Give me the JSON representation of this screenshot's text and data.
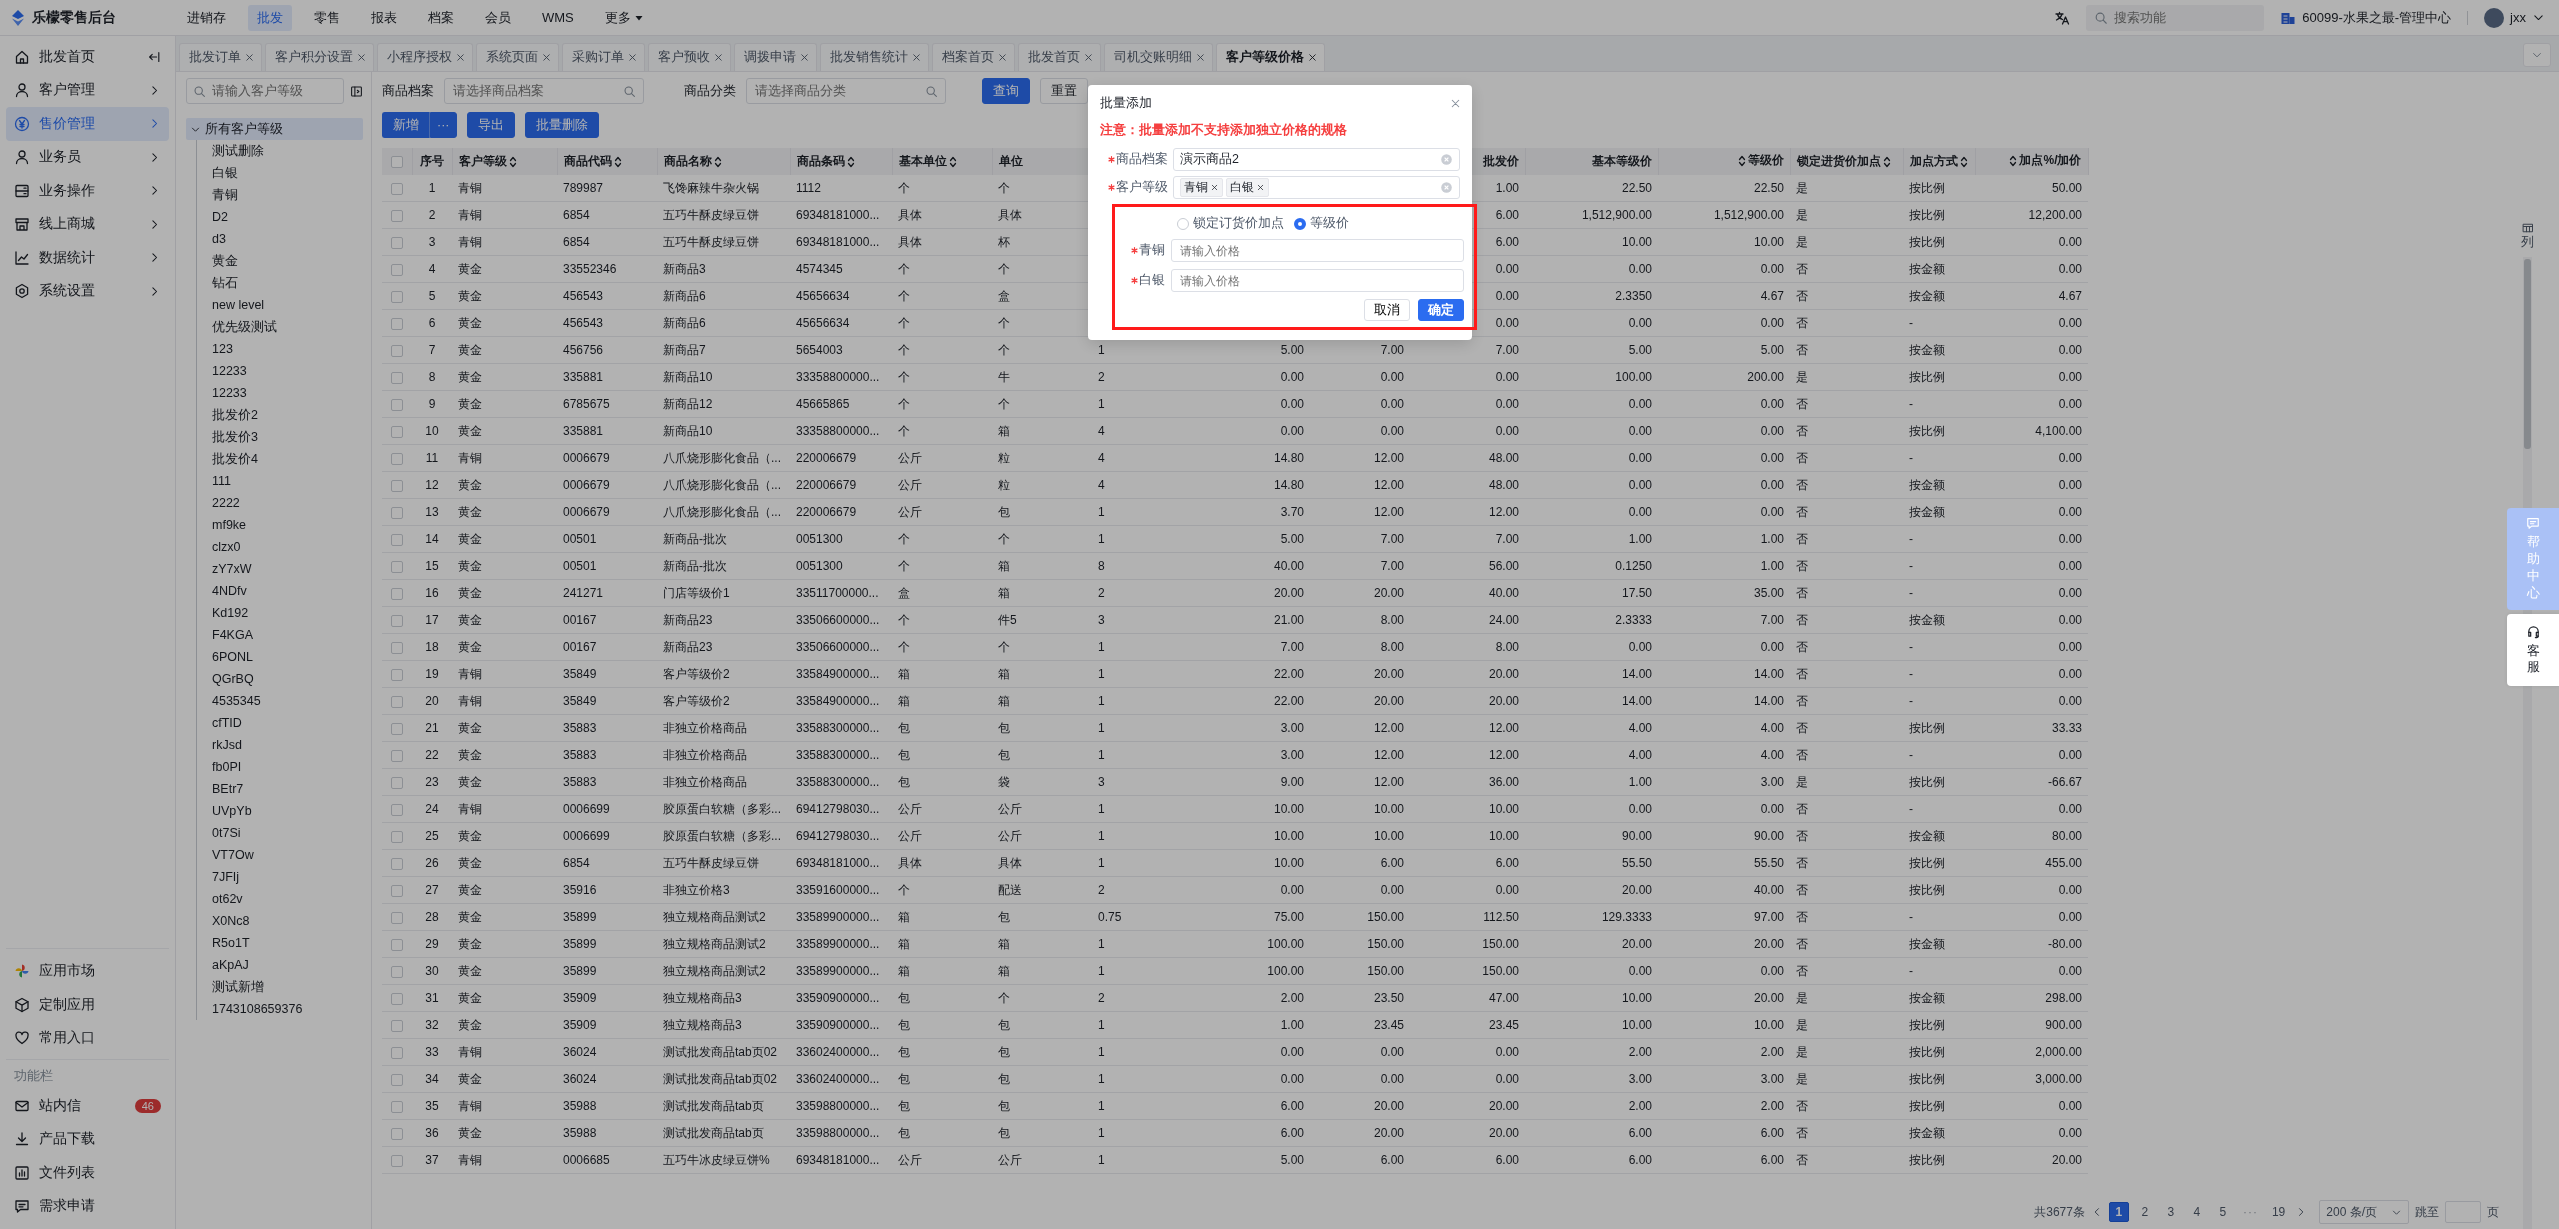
{
  "header": {
    "logo": "乐檬零售后台",
    "menu": [
      {
        "label": "进销存",
        "selected": false,
        "has_menu": false
      },
      {
        "label": "批发",
        "selected": true,
        "has_menu": false
      },
      {
        "label": "零售",
        "selected": false,
        "has_menu": false
      },
      {
        "label": "报表",
        "selected": false,
        "has_menu": false
      },
      {
        "label": "档案",
        "selected": false,
        "has_menu": false
      },
      {
        "label": "会员",
        "selected": false,
        "has_menu": false
      },
      {
        "label": "WMS",
        "selected": false,
        "has_menu": false
      },
      {
        "label": "更多",
        "selected": false,
        "has_menu": true
      }
    ],
    "search": {
      "placeholder": "搜索功能"
    },
    "org": "60099-水果之最-管理中心",
    "user": "jxx"
  },
  "sidebar": {
    "items": [
      {
        "label": "批发首页",
        "selected": false
      },
      {
        "label": "客户管理",
        "selected": false
      },
      {
        "label": "售价管理",
        "selected": true
      },
      {
        "label": "业务员",
        "selected": false
      },
      {
        "label": "业务操作",
        "selected": false
      },
      {
        "label": "线上商城",
        "selected": false
      },
      {
        "label": "数据统计",
        "selected": false
      },
      {
        "label": "系统设置",
        "selected": false
      }
    ],
    "apps": [
      "应用市场",
      "定制应用",
      "常用入口"
    ],
    "section_title": "功能栏",
    "tools": [
      {
        "label": "站内信",
        "badge": "46"
      },
      {
        "label": "产品下载"
      },
      {
        "label": "文件列表"
      },
      {
        "label": "需求申请"
      }
    ]
  },
  "tabs": [
    {
      "label": "批发订单",
      "selected": false
    },
    {
      "label": "客户积分设置",
      "selected": false
    },
    {
      "label": "小程序授权",
      "selected": false
    },
    {
      "label": "系统页面",
      "selected": false
    },
    {
      "label": "采购订单",
      "selected": false
    },
    {
      "label": "客户预收",
      "selected": false
    },
    {
      "label": "调拨申请",
      "selected": false
    },
    {
      "label": "批发销售统计",
      "selected": false
    },
    {
      "label": "档案首页",
      "selected": false
    },
    {
      "label": "批发首页",
      "selected": false
    },
    {
      "label": "司机交账明细",
      "selected": false
    },
    {
      "label": "客户等级价格",
      "selected": true
    }
  ],
  "tree": {
    "search_placeholder": "请输入客户等级",
    "root": {
      "label": "所有客户等级",
      "expanded": true,
      "selected": true,
      "children": [
        {
          "label": "测试删除",
          "selected": false
        },
        {
          "label": "白银",
          "selected": false
        },
        {
          "label": "青铜",
          "selected": false
        },
        {
          "label": "D2",
          "selected": false
        },
        {
          "label": "d3",
          "selected": false
        },
        {
          "label": "黄金",
          "selected": false
        },
        {
          "label": "钻石",
          "selected": false
        },
        {
          "label": "new level",
          "selected": false
        },
        {
          "label": "优先级测试",
          "selected": false
        },
        {
          "label": "123",
          "selected": false
        },
        {
          "label": "12233",
          "selected": false
        },
        {
          "label": "12233",
          "selected": false
        },
        {
          "label": "批发价2",
          "selected": false
        },
        {
          "label": "批发价3",
          "selected": false
        },
        {
          "label": "批发价4",
          "selected": false
        },
        {
          "label": "111",
          "selected": false
        },
        {
          "label": "2222",
          "selected": false
        },
        {
          "label": "mf9ke",
          "selected": false
        },
        {
          "label": "clzx0",
          "selected": false
        },
        {
          "label": "zY7xW",
          "selected": false
        },
        {
          "label": "4NDfv",
          "selected": false
        },
        {
          "label": "Kd192",
          "selected": false
        },
        {
          "label": "F4KGA",
          "selected": false
        },
        {
          "label": "6PONL",
          "selected": false
        },
        {
          "label": "QGrBQ",
          "selected": false
        },
        {
          "label": "4535345",
          "selected": false
        },
        {
          "label": "cfTID",
          "selected": false
        },
        {
          "label": "rkJsd",
          "selected": false
        },
        {
          "label": "fb0PI",
          "selected": false
        },
        {
          "label": "BEtr7",
          "selected": false
        },
        {
          "label": "UVpYb",
          "selected": false
        },
        {
          "label": "0t7Si",
          "selected": false
        },
        {
          "label": "VT7Ow",
          "selected": false
        },
        {
          "label": "7JFIj",
          "selected": false
        },
        {
          "label": "ot62v",
          "selected": false
        },
        {
          "label": "X0Nc8",
          "selected": false
        },
        {
          "label": "R5o1T",
          "selected": false
        },
        {
          "label": "aKpAJ",
          "selected": false
        },
        {
          "label": "测试新增",
          "selected": false
        },
        {
          "label": "1743108659376",
          "selected": false
        }
      ]
    }
  },
  "filters": [
    {
      "label": "商品档案",
      "placeholder": "请选择商品档案"
    },
    {
      "label": "商品分类",
      "placeholder": "请选择商品分类"
    }
  ],
  "filter_buttons": [
    {
      "label": "查询",
      "primary": true
    },
    {
      "label": "重置",
      "primary": false
    }
  ],
  "toolbar": {
    "add": "新增",
    "add_more": "···",
    "buttons": [
      "导出",
      "批量删除"
    ]
  },
  "table": {
    "all_checked": false,
    "columns": [
      {
        "label": "序号",
        "sort_before": false,
        "sort_after": false
      },
      {
        "label": "客户等级",
        "sort_before": false,
        "sort_after": true
      },
      {
        "label": "商品代码",
        "sort_before": false,
        "sort_after": true
      },
      {
        "label": "商品名称",
        "sort_before": false,
        "sort_after": true
      },
      {
        "label": "商品条码",
        "sort_before": false,
        "sort_after": true
      },
      {
        "label": "基本单位",
        "sort_before": false,
        "sort_after": true
      },
      {
        "label": "单位",
        "sort_before": false,
        "sort_after": false
      },
      null,
      null,
      null,
      {
        "label": "批发价",
        "sort_before": false,
        "sort_after": false
      },
      {
        "label": "基本等级价",
        "sort_before": false,
        "sort_after": false
      },
      {
        "label": "等级价",
        "sort_before": true,
        "sort_after": false
      },
      {
        "label": "锁定进货价加点",
        "sort_before": false,
        "sort_after": true
      },
      {
        "label": "加点方式",
        "sort_before": false,
        "sort_after": true
      },
      {
        "label": "加点%/加价",
        "sort_before": true,
        "sort_after": false
      }
    ],
    "rows": [
      {
        "checked": false,
        "cells": [
          "1",
          "青铜",
          "789987",
          "飞馋麻辣牛杂火锅",
          "1112",
          "个",
          "个",
          null,
          null,
          null,
          "1.00",
          "22.50",
          "22.50",
          "是",
          "按比例",
          "50.00"
        ]
      },
      {
        "checked": false,
        "cells": [
          "2",
          "青铜",
          "6854",
          "五巧牛酥皮绿豆饼",
          "69348181000...",
          "具体",
          "具体",
          null,
          null,
          null,
          "6.00",
          "1,512,900.00",
          "1,512,900.00",
          "是",
          "按比例",
          "12,200.00"
        ]
      },
      {
        "checked": false,
        "cells": [
          "3",
          "青铜",
          "6854",
          "五巧牛酥皮绿豆饼",
          "69348181000...",
          "具体",
          "杯",
          null,
          null,
          null,
          "6.00",
          "10.00",
          "10.00",
          "是",
          "按比例",
          "0.00"
        ]
      },
      {
        "checked": false,
        "cells": [
          "4",
          "黄金",
          "33552346",
          "新商品3",
          "4574345",
          "个",
          "个",
          null,
          null,
          null,
          "0.00",
          "0.00",
          "0.00",
          "否",
          "按金额",
          "0.00"
        ]
      },
      {
        "checked": false,
        "cells": [
          "5",
          "黄金",
          "456543",
          "新商品6",
          "45656634",
          "个",
          "盒",
          null,
          null,
          null,
          "0.00",
          "2.3350",
          "4.67",
          "否",
          "按金额",
          "4.67"
        ]
      },
      {
        "checked": false,
        "cells": [
          "6",
          "黄金",
          "456543",
          "新商品6",
          "45656634",
          "个",
          "个",
          null,
          null,
          null,
          "0.00",
          "0.00",
          "0.00",
          "否",
          "-",
          "0.00"
        ]
      },
      {
        "checked": false,
        "cells": [
          "7",
          "黄金",
          "456756",
          "新商品7",
          "5654003",
          "个",
          "个",
          "1",
          "5.00",
          "7.00",
          "7.00",
          "5.00",
          "5.00",
          "否",
          "按金额",
          "0.00"
        ]
      },
      {
        "checked": false,
        "cells": [
          "8",
          "黄金",
          "335881",
          "新商品10",
          "33358800000...",
          "个",
          "牛",
          "2",
          "0.00",
          "0.00",
          "0.00",
          "100.00",
          "200.00",
          "是",
          "按比例",
          "0.00"
        ]
      },
      {
        "checked": false,
        "cells": [
          "9",
          "黄金",
          "6785675",
          "新商品12",
          "45665865",
          "个",
          "个",
          "1",
          "0.00",
          "0.00",
          "0.00",
          "0.00",
          "0.00",
          "否",
          "-",
          "0.00"
        ]
      },
      {
        "checked": false,
        "cells": [
          "10",
          "黄金",
          "335881",
          "新商品10",
          "33358800000...",
          "个",
          "箱",
          "4",
          "0.00",
          "0.00",
          "0.00",
          "0.00",
          "0.00",
          "否",
          "按比例",
          "4,100.00"
        ]
      },
      {
        "checked": false,
        "cells": [
          "11",
          "青铜",
          "0006679",
          "八爪烧形膨化食品（...",
          "220006679",
          "公斤",
          "粒",
          "4",
          "14.80",
          "12.00",
          "48.00",
          "0.00",
          "0.00",
          "否",
          "-",
          "0.00"
        ]
      },
      {
        "checked": false,
        "cells": [
          "12",
          "黄金",
          "0006679",
          "八爪烧形膨化食品（...",
          "220006679",
          "公斤",
          "粒",
          "4",
          "14.80",
          "12.00",
          "48.00",
          "0.00",
          "0.00",
          "否",
          "按金额",
          "0.00"
        ]
      },
      {
        "checked": false,
        "cells": [
          "13",
          "黄金",
          "0006679",
          "八爪烧形膨化食品（...",
          "220006679",
          "公斤",
          "包",
          "1",
          "3.70",
          "12.00",
          "12.00",
          "0.00",
          "0.00",
          "否",
          "按金额",
          "0.00"
        ]
      },
      {
        "checked": false,
        "cells": [
          "14",
          "黄金",
          "00501",
          "新商品-批次",
          "0051300",
          "个",
          "个",
          "1",
          "5.00",
          "7.00",
          "7.00",
          "1.00",
          "1.00",
          "否",
          "-",
          "0.00"
        ]
      },
      {
        "checked": false,
        "cells": [
          "15",
          "黄金",
          "00501",
          "新商品-批次",
          "0051300",
          "个",
          "箱",
          "8",
          "40.00",
          "7.00",
          "56.00",
          "0.1250",
          "1.00",
          "否",
          "-",
          "0.00"
        ]
      },
      {
        "checked": false,
        "cells": [
          "16",
          "黄金",
          "241271",
          "门店等级价1",
          "33511700000...",
          "盒",
          "箱",
          "2",
          "20.00",
          "20.00",
          "40.00",
          "17.50",
          "35.00",
          "否",
          "-",
          "0.00"
        ]
      },
      {
        "checked": false,
        "cells": [
          "17",
          "黄金",
          "00167",
          "新商品23",
          "33506600000...",
          "个",
          "件5",
          "3",
          "21.00",
          "8.00",
          "24.00",
          "2.3333",
          "7.00",
          "否",
          "按金额",
          "0.00"
        ]
      },
      {
        "checked": false,
        "cells": [
          "18",
          "黄金",
          "00167",
          "新商品23",
          "33506600000...",
          "个",
          "个",
          "1",
          "7.00",
          "8.00",
          "8.00",
          "0.00",
          "0.00",
          "否",
          "-",
          "0.00"
        ]
      },
      {
        "checked": false,
        "cells": [
          "19",
          "青铜",
          "35849",
          "客户等级价2",
          "33584900000...",
          "箱",
          "箱",
          "1",
          "22.00",
          "20.00",
          "20.00",
          "14.00",
          "14.00",
          "否",
          "-",
          "0.00"
        ]
      },
      {
        "checked": false,
        "cells": [
          "20",
          "青铜",
          "35849",
          "客户等级价2",
          "33584900000...",
          "箱",
          "箱",
          "1",
          "22.00",
          "20.00",
          "20.00",
          "14.00",
          "14.00",
          "否",
          "-",
          "0.00"
        ]
      },
      {
        "checked": false,
        "cells": [
          "21",
          "黄金",
          "35883",
          "非独立价格商品",
          "33588300000...",
          "包",
          "包",
          "1",
          "3.00",
          "12.00",
          "12.00",
          "4.00",
          "4.00",
          "否",
          "按比例",
          "33.33"
        ]
      },
      {
        "checked": false,
        "cells": [
          "22",
          "黄金",
          "35883",
          "非独立价格商品",
          "33588300000...",
          "包",
          "包",
          "1",
          "3.00",
          "12.00",
          "12.00",
          "4.00",
          "4.00",
          "否",
          "-",
          "0.00"
        ]
      },
      {
        "checked": false,
        "cells": [
          "23",
          "黄金",
          "35883",
          "非独立价格商品",
          "33588300000...",
          "包",
          "袋",
          "3",
          "9.00",
          "12.00",
          "36.00",
          "1.00",
          "3.00",
          "是",
          "按比例",
          "-66.67"
        ]
      },
      {
        "checked": false,
        "cells": [
          "24",
          "青铜",
          "0006699",
          "胶原蛋白软糖（多彩...",
          "69412798030...",
          "公斤",
          "公斤",
          "1",
          "10.00",
          "10.00",
          "10.00",
          "0.00",
          "0.00",
          "否",
          "-",
          "0.00"
        ]
      },
      {
        "checked": false,
        "cells": [
          "25",
          "黄金",
          "0006699",
          "胶原蛋白软糖（多彩...",
          "69412798030...",
          "公斤",
          "公斤",
          "1",
          "10.00",
          "10.00",
          "10.00",
          "90.00",
          "90.00",
          "否",
          "按金额",
          "80.00"
        ]
      },
      {
        "checked": false,
        "cells": [
          "26",
          "黄金",
          "6854",
          "五巧牛酥皮绿豆饼",
          "69348181000...",
          "具体",
          "具体",
          "1",
          "10.00",
          "6.00",
          "6.00",
          "55.50",
          "55.50",
          "否",
          "按比例",
          "455.00"
        ]
      },
      {
        "checked": false,
        "cells": [
          "27",
          "黄金",
          "35916",
          "非独立价格3",
          "33591600000...",
          "个",
          "配送",
          "2",
          "0.00",
          "0.00",
          "0.00",
          "20.00",
          "40.00",
          "否",
          "按比例",
          "0.00"
        ]
      },
      {
        "checked": false,
        "cells": [
          "28",
          "黄金",
          "35899",
          "独立规格商品测试2",
          "33589900000...",
          "箱",
          "包",
          "0.75",
          "75.00",
          "150.00",
          "112.50",
          "129.3333",
          "97.00",
          "否",
          "-",
          "0.00"
        ]
      },
      {
        "checked": false,
        "cells": [
          "29",
          "黄金",
          "35899",
          "独立规格商品测试2",
          "33589900000...",
          "箱",
          "箱",
          "1",
          "100.00",
          "150.00",
          "150.00",
          "20.00",
          "20.00",
          "否",
          "按金额",
          "-80.00"
        ]
      },
      {
        "checked": false,
        "cells": [
          "30",
          "黄金",
          "35899",
          "独立规格商品测试2",
          "33589900000...",
          "箱",
          "箱",
          "1",
          "100.00",
          "150.00",
          "150.00",
          "0.00",
          "0.00",
          "否",
          "-",
          "0.00"
        ]
      },
      {
        "checked": false,
        "cells": [
          "31",
          "黄金",
          "35909",
          "独立规格商品3",
          "33590900000...",
          "包",
          "个",
          "2",
          "2.00",
          "23.50",
          "47.00",
          "10.00",
          "20.00",
          "是",
          "按金额",
          "298.00"
        ]
      },
      {
        "checked": false,
        "cells": [
          "32",
          "黄金",
          "35909",
          "独立规格商品3",
          "33590900000...",
          "包",
          "包",
          "1",
          "1.00",
          "23.45",
          "23.45",
          "10.00",
          "10.00",
          "是",
          "按比例",
          "900.00"
        ]
      },
      {
        "checked": false,
        "cells": [
          "33",
          "青铜",
          "36024",
          "测试批发商品tab页02",
          "33602400000...",
          "包",
          "包",
          "1",
          "0.00",
          "0.00",
          "0.00",
          "2.00",
          "2.00",
          "是",
          "按比例",
          "2,000.00"
        ]
      },
      {
        "checked": false,
        "cells": [
          "34",
          "黄金",
          "36024",
          "测试批发商品tab页02",
          "33602400000...",
          "包",
          "包",
          "1",
          "0.00",
          "0.00",
          "0.00",
          "3.00",
          "3.00",
          "是",
          "按比例",
          "3,000.00"
        ]
      },
      {
        "checked": false,
        "cells": [
          "35",
          "青铜",
          "35988",
          "测试批发商品tab页",
          "33598800000...",
          "包",
          "包",
          "1",
          "6.00",
          "20.00",
          "20.00",
          "2.00",
          "2.00",
          "否",
          "按比例",
          "0.00"
        ]
      },
      {
        "checked": false,
        "cells": [
          "36",
          "黄金",
          "35988",
          "测试批发商品tab页",
          "33598800000...",
          "包",
          "包",
          "1",
          "6.00",
          "20.00",
          "20.00",
          "6.00",
          "6.00",
          "否",
          "按金额",
          "0.00"
        ]
      },
      {
        "checked": false,
        "cells": [
          "37",
          "青铜",
          "0006685",
          "五巧牛冰皮绿豆饼%",
          "69348181000...",
          "公斤",
          "公斤",
          "1",
          "5.00",
          "6.00",
          "6.00",
          "6.00",
          "6.00",
          "否",
          "按比例",
          "20.00"
        ]
      }
    ]
  },
  "column_settings": "列",
  "pagination": {
    "total": "共3677条",
    "pages": [
      {
        "kind": "page",
        "label": "1",
        "selected": true
      },
      {
        "kind": "page",
        "label": "2",
        "selected": false
      },
      {
        "kind": "page",
        "label": "3",
        "selected": false
      },
      {
        "kind": "page",
        "label": "4",
        "selected": false
      },
      {
        "kind": "page",
        "label": "5",
        "selected": false
      },
      {
        "kind": "ellipsis",
        "label": "···",
        "selected": false
      },
      {
        "kind": "page",
        "label": "19",
        "selected": false
      }
    ],
    "page_size": "200 条/页",
    "jump_label": "跳至",
    "page_unit": "页"
  },
  "modal": {
    "title": "批量添加",
    "notice": "注意：批量添加不支持添加独立价格的规格",
    "fields": [
      {
        "kind": "select",
        "label": "商品档案",
        "required": true,
        "value": "演示商品2"
      },
      {
        "kind": "tags",
        "label": "客户等级",
        "required": true,
        "tags": [
          "青铜",
          "白银"
        ]
      }
    ],
    "price_section": {
      "highlighted": true,
      "modes": [
        {
          "label": "锁定订货价加点",
          "selected": false
        },
        {
          "label": "等级价",
          "selected": true
        }
      ],
      "inputs": [
        {
          "label": "青铜",
          "required": true,
          "placeholder": "请输入价格"
        },
        {
          "label": "白银",
          "required": true,
          "placeholder": "请输入价格"
        }
      ]
    },
    "buttons": [
      {
        "label": "取消",
        "primary": false
      },
      {
        "label": "确定",
        "primary": true
      }
    ]
  },
  "float": {
    "help": "帮助中心",
    "support": "客服"
  }
}
